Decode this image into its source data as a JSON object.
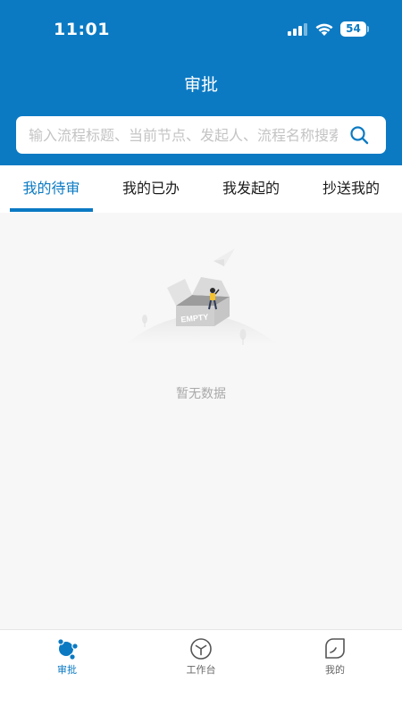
{
  "status_bar": {
    "time": "11:01",
    "battery": "54"
  },
  "header": {
    "title": "审批"
  },
  "search": {
    "placeholder": "输入流程标题、当前节点、发起人、流程名称搜索"
  },
  "tabs": [
    {
      "label": "我的待审",
      "active": true
    },
    {
      "label": "我的已办",
      "active": false
    },
    {
      "label": "我发起的",
      "active": false
    },
    {
      "label": "抄送我的",
      "active": false
    }
  ],
  "empty_state": {
    "box_label": "EMPTY",
    "message": "暂无数据"
  },
  "bottom_nav": [
    {
      "label": "审批",
      "icon": "approval-icon",
      "active": true
    },
    {
      "label": "工作台",
      "icon": "cube-icon",
      "active": false
    },
    {
      "label": "我的",
      "icon": "leaf-icon",
      "active": false
    }
  ],
  "colors": {
    "primary": "#0b7ac3",
    "background": "#f7f7f7",
    "muted_text": "#a9a9a9"
  }
}
